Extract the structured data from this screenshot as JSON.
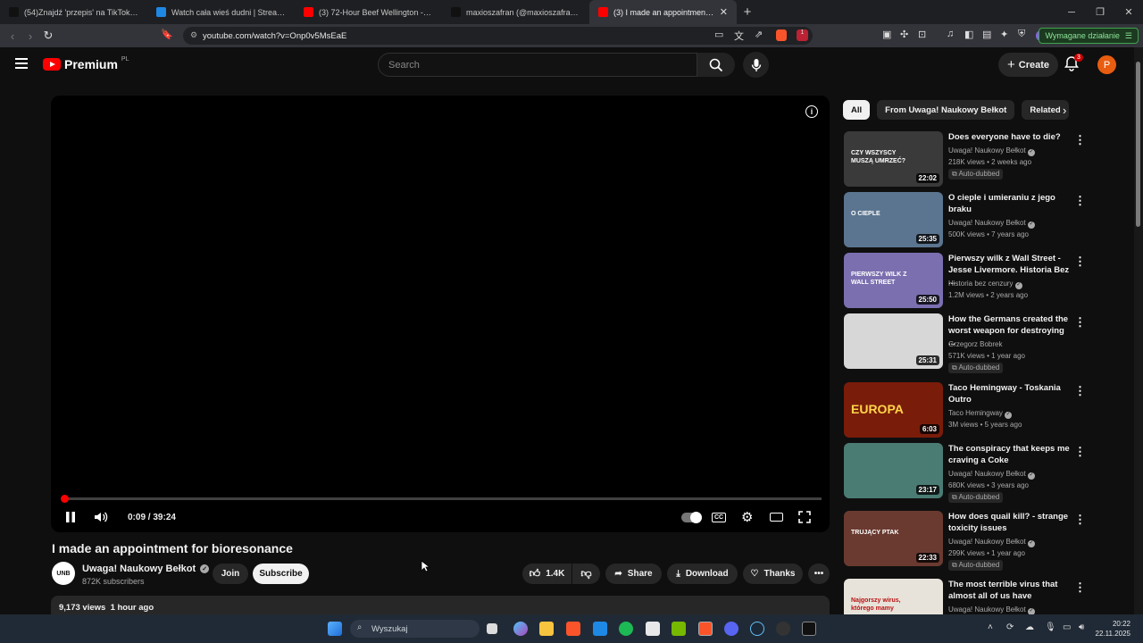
{
  "browser": {
    "tabs": [
      {
        "label": "(54)Znajdź 'przepis' na TikTok | Wysz...",
        "color": "#111111"
      },
      {
        "label": "Watch cała wieś dudni | Streamable",
        "color": "#1e88e5"
      },
      {
        "label": "(3) 72-Hour Beef Wellington - YouTub...",
        "color": "#ff0000"
      },
      {
        "label": "maxioszafran (@maxioszafran) | TikTo...",
        "color": "#111111"
      },
      {
        "label": "(3) I made an appointment fo",
        "color": "#ff0000",
        "active": true
      }
    ],
    "url": "youtube.com/watch?v=Onp0v5MsEaE",
    "action_required": "Wymagane działanie",
    "ext_badge": "1"
  },
  "header": {
    "logo": "Premium",
    "region": "PL",
    "search_placeholder": "Search",
    "create": "Create",
    "notif_count": "3",
    "avatar_letter": "P"
  },
  "player": {
    "current_time": "0:09",
    "duration": "39:24",
    "progress_fraction": 0.0038
  },
  "video": {
    "title": "I made an appointment for bioresonance",
    "channel": "Uwaga! Naukowy Bełkot",
    "channel_avatar": "UNB",
    "subscribers": "872K subscribers",
    "join": "Join",
    "subscribe": "Subscribe",
    "likes": "1.4K",
    "share": "Share",
    "download": "Download",
    "thanks": "Thanks",
    "views": "9,173 views",
    "age": "1 hour ago"
  },
  "sidebar": {
    "chips": [
      "All",
      "From Uwaga! Naukowy Bełkot",
      "Related"
    ],
    "recs": [
      {
        "title": "Does everyone have to die?",
        "channel": "Uwaga! Naukowy Bełkot",
        "stats": "218K views • 2 weeks ago",
        "duration": "22:02",
        "autodub": "Auto-dubbed",
        "thumb": "CZY WSZYSCY MUSZĄ UMRZEĆ?",
        "bg": "#3a3a3a",
        "verified": true
      },
      {
        "title": "O cieple i umieraniu z jego braku",
        "channel": "Uwaga! Naukowy Bełkot",
        "stats": "500K views • 7 years ago",
        "duration": "25:35",
        "autodub": "",
        "thumb": "O CIEPLE",
        "bg": "#5b7590",
        "verified": true
      },
      {
        "title": "Pierwszy wilk z Wall Street - Jesse Livermore. Historia Bez ...",
        "channel": "Historia bez cenzury",
        "stats": "1.2M views • 2 years ago",
        "duration": "25:50",
        "autodub": "",
        "thumb": "PIERWSZY WILK Z WALL STREET",
        "bg": "#7b6fb0",
        "verified": true
      },
      {
        "title": "How the Germans created the worst weapon for destroying ...",
        "channel": "Grzegorz Bobrek",
        "stats": "571K views • 1 year ago",
        "duration": "25:31",
        "autodub": "Auto-dubbed",
        "thumb": "",
        "bg": "#d7d7d7",
        "verified": false
      },
      {
        "title": "Taco Hemingway - Toskania Outro",
        "channel": "Taco Hemingway",
        "stats": "3M views • 5 years ago",
        "duration": "6:03",
        "autodub": "",
        "thumb": "EUROPA",
        "bg": "#7a1c0a",
        "verified": true
      },
      {
        "title": "The conspiracy that keeps me craving a Coke",
        "channel": "Uwaga! Naukowy Bełkot",
        "stats": "680K views • 3 years ago",
        "duration": "23:17",
        "autodub": "Auto-dubbed",
        "thumb": "",
        "bg": "#4a7c74",
        "verified": true
      },
      {
        "title": "How does quail kill? - strange toxicity issues",
        "channel": "Uwaga! Naukowy Bełkot",
        "stats": "299K views • 1 year ago",
        "duration": "22:33",
        "autodub": "Auto-dubbed",
        "thumb": "TRUJĄCY PTAK",
        "bg": "#6a3a30",
        "verified": true
      },
      {
        "title": "The most terrible virus that almost all of us have",
        "channel": "Uwaga! Naukowy Bełkot",
        "stats": "",
        "duration": "",
        "autodub": "",
        "thumb": "Najgorszy wirus, którego mamy",
        "bg": "#e7e3da",
        "verified": true
      }
    ]
  },
  "taskbar": {
    "search": "Wyszukaj",
    "time": "20:22",
    "date": "22.11.2025"
  },
  "colors": {
    "accent": "#ff0000",
    "bg": "#0f0f0f",
    "chip": "#272727"
  }
}
